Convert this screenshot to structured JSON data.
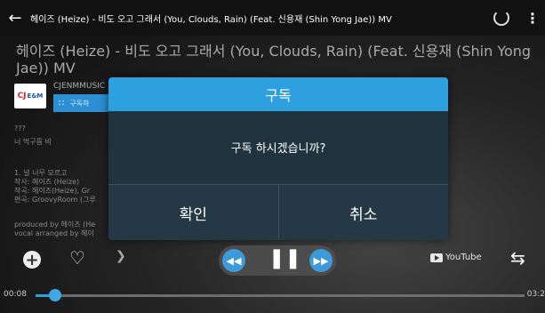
{
  "topbar": {
    "title": "헤이즈 (Heize) - 비도 오고 그래서 (You, Clouds, Rain) (Feat. 신용재 (Shin Yong Jae)) MV",
    "back_icon": "arrow-left-icon",
    "loading_icon": "spinner-icon",
    "menu_icon": "kebab-menu-icon"
  },
  "video": {
    "title": "헤이즈 (Heize) - 비도 오고 그래서 (You, Clouds, Rain) (Feat. 신용재 (Shin Yong Jae)) MV",
    "channel_name": "CJENMMUSIC",
    "logo_text": "CJ E&M",
    "subscribe_label": "구독하",
    "desc_lines": [
      "???",
      "너 먹구름 비",
      "",
      "1. 널 너무 모르고",
      "작사: 헤이즈 (Heize)",
      "작곡: 헤이즈(Heize), Gr",
      "편곡: GroovyRoom (그루",
      "",
      "produced by 헤이즈 (He",
      "vocal arranged by 헤이"
    ]
  },
  "dialog": {
    "title": "구독",
    "message": "구독 하시겠습니까?",
    "confirm_label": "확인",
    "cancel_label": "취소"
  },
  "controls": {
    "add_icon": "plus-circle-icon",
    "like_icon": "heart-icon",
    "subscribe_icon": "rss-icon",
    "rewind_icon": "rewind-icon",
    "pause_icon": "pause-icon",
    "forward_icon": "fast-forward-icon",
    "youtube_label": "YouTube",
    "repeat_icon": "repeat-icon"
  },
  "progress": {
    "elapsed": "00:08",
    "total": "03:2",
    "played_fraction": 0.04
  },
  "colors": {
    "accent": "#2ea0df",
    "dialog_bg": "#20343f"
  }
}
